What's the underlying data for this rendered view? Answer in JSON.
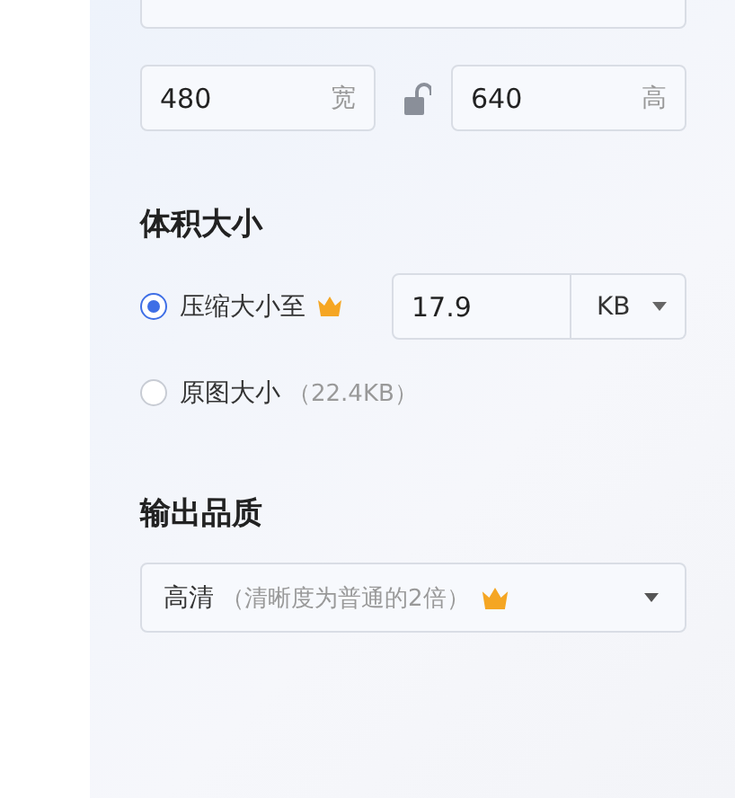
{
  "width_field": {
    "value": "480",
    "suffix": "宽"
  },
  "height_field": {
    "value": "640",
    "suffix": "高"
  },
  "aspect_lock": {
    "locked": false
  },
  "size_section": {
    "title": "体积大小",
    "options": [
      {
        "kind": "compress",
        "label": "压缩大小至",
        "selected": true,
        "value": "17.9",
        "unit": "KB"
      },
      {
        "kind": "original",
        "label": "原图大小",
        "note": "（22.4KB）",
        "selected": false
      }
    ]
  },
  "quality_section": {
    "title": "输出品质",
    "value": "高清",
    "note": "（清晰度为普通的2倍）"
  }
}
